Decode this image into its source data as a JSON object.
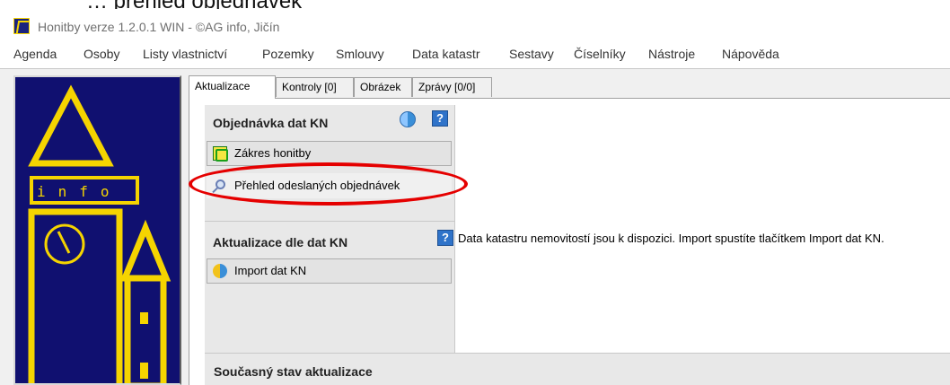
{
  "clipped_heading": "… přehled objednávek",
  "window": {
    "title": "Honitby verze 1.2.0.1 WIN - ©AG info, Jičín"
  },
  "menu": [
    "Agenda",
    "Osoby",
    "Listy vlastnictví",
    "Pozemky",
    "Smlouvy",
    "Data katastr",
    "Sestavy",
    "Číselníky",
    "Nástroje",
    "Nápověda"
  ],
  "logo": {
    "text": "info",
    "colors": {
      "background": "#101070",
      "accent": "#f5d400"
    }
  },
  "tabs": [
    {
      "label": "Aktualizace",
      "active": true
    },
    {
      "label": "Kontroly [0]"
    },
    {
      "label": "Obrázek"
    },
    {
      "label": "Zprávy [0/0]"
    }
  ],
  "section_order": {
    "title": "Objednávka dat KN",
    "buttons": {
      "zakres": "Zákres honitby",
      "prehled": "Přehled odeslaných objednávek"
    }
  },
  "section_update": {
    "title": "Aktualizace dle dat KN",
    "button_import": "Import dat KN",
    "message": "Data katastru nemovitostí jsou k dispozici. Import spustíte tlačítkem Import dat KN."
  },
  "section_status": {
    "title": "Současný stav aktualizace"
  },
  "icons": {
    "sync": "sync-icon",
    "help": "help-icon",
    "map": "map-icon",
    "search": "search-icon",
    "import": "import-icon"
  },
  "highlight_color": "#e50000"
}
